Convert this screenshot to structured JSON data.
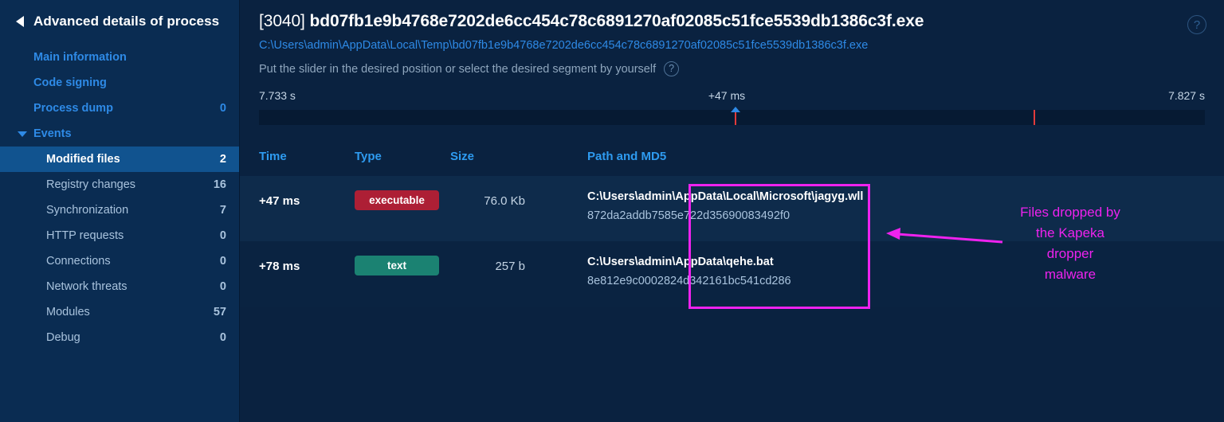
{
  "colors": {
    "sidebar_bg": "#0a2c52",
    "main_bg": "#0a2240",
    "accent_link": "#2e8ae6",
    "active_row": "#11538f",
    "badge_executable": "#ad1f35",
    "badge_text": "#1b8272",
    "timeline_tick": "#e23b3b",
    "annotation": "#ee22ee"
  },
  "sidebar": {
    "back_icon": "back-arrow-icon",
    "title": "Advanced details of process",
    "items": [
      {
        "label": "Main information",
        "count": "",
        "level": 1,
        "active": false,
        "caret": ""
      },
      {
        "label": "Code signing",
        "count": "",
        "level": 1,
        "active": false,
        "caret": ""
      },
      {
        "label": "Process dump",
        "count": "0",
        "level": 1,
        "active": false,
        "caret": ""
      },
      {
        "label": "Events",
        "count": "",
        "level": 1,
        "active": false,
        "caret": "chevron-down-icon"
      },
      {
        "label": "Modified files",
        "count": "2",
        "level": 2,
        "active": true,
        "caret": ""
      },
      {
        "label": "Registry changes",
        "count": "16",
        "level": 2,
        "active": false,
        "caret": ""
      },
      {
        "label": "Synchronization",
        "count": "7",
        "level": 2,
        "active": false,
        "caret": ""
      },
      {
        "label": "HTTP requests",
        "count": "0",
        "level": 2,
        "active": false,
        "caret": ""
      },
      {
        "label": "Connections",
        "count": "0",
        "level": 2,
        "active": false,
        "caret": ""
      },
      {
        "label": "Network threats",
        "count": "0",
        "level": 2,
        "active": false,
        "caret": ""
      },
      {
        "label": "Modules",
        "count": "57",
        "level": 2,
        "active": false,
        "caret": ""
      },
      {
        "label": "Debug",
        "count": "0",
        "level": 2,
        "active": false,
        "caret": ""
      }
    ]
  },
  "header": {
    "pid": "[3040] ",
    "process_name": "bd07fb1e9b4768e7202de6cc454c78c6891270af02085c51fce5539db1386c3f.exe",
    "process_path": "C:\\Users\\admin\\AppData\\Local\\Temp\\bd07fb1e9b4768e7202de6cc454c78c6891270af02085c51fce5539db1386c3f.exe",
    "hint": "Put the slider in the desired position or select the desired segment by yourself",
    "help_glyph": "?",
    "help_icon": "help-circle-icon",
    "corner_help_glyph": "?"
  },
  "timeline": {
    "start_label": "7.733 s",
    "selected_label": "+47 ms",
    "end_label": "7.827 s",
    "ticks_percent": [
      50.3,
      81.9
    ],
    "handle_percent": 50.3
  },
  "table": {
    "columns": [
      "Time",
      "Type",
      "Size",
      "Path and MD5"
    ],
    "rows": [
      {
        "time": "+47 ms",
        "type": "executable",
        "type_color": "#ad1f35",
        "size": "76.0 Kb",
        "path": "C:\\Users\\admin\\AppData\\Local\\Microsoft\\jagyg.wll",
        "md5": "872da2addb7585e722d35690083492f0"
      },
      {
        "time": "+78 ms",
        "type": "text",
        "type_color": "#1b8272",
        "size": "257 b",
        "path": "C:\\Users\\admin\\AppData\\qehe.bat",
        "md5": "8e812e9c0002824d342161bc541cd286"
      }
    ]
  },
  "annotation": {
    "text_lines": [
      "Files dropped by",
      "the Kapeka",
      "dropper",
      "malware"
    ],
    "text": "Files dropped by\nthe Kapeka\ndropper\nmalware"
  }
}
